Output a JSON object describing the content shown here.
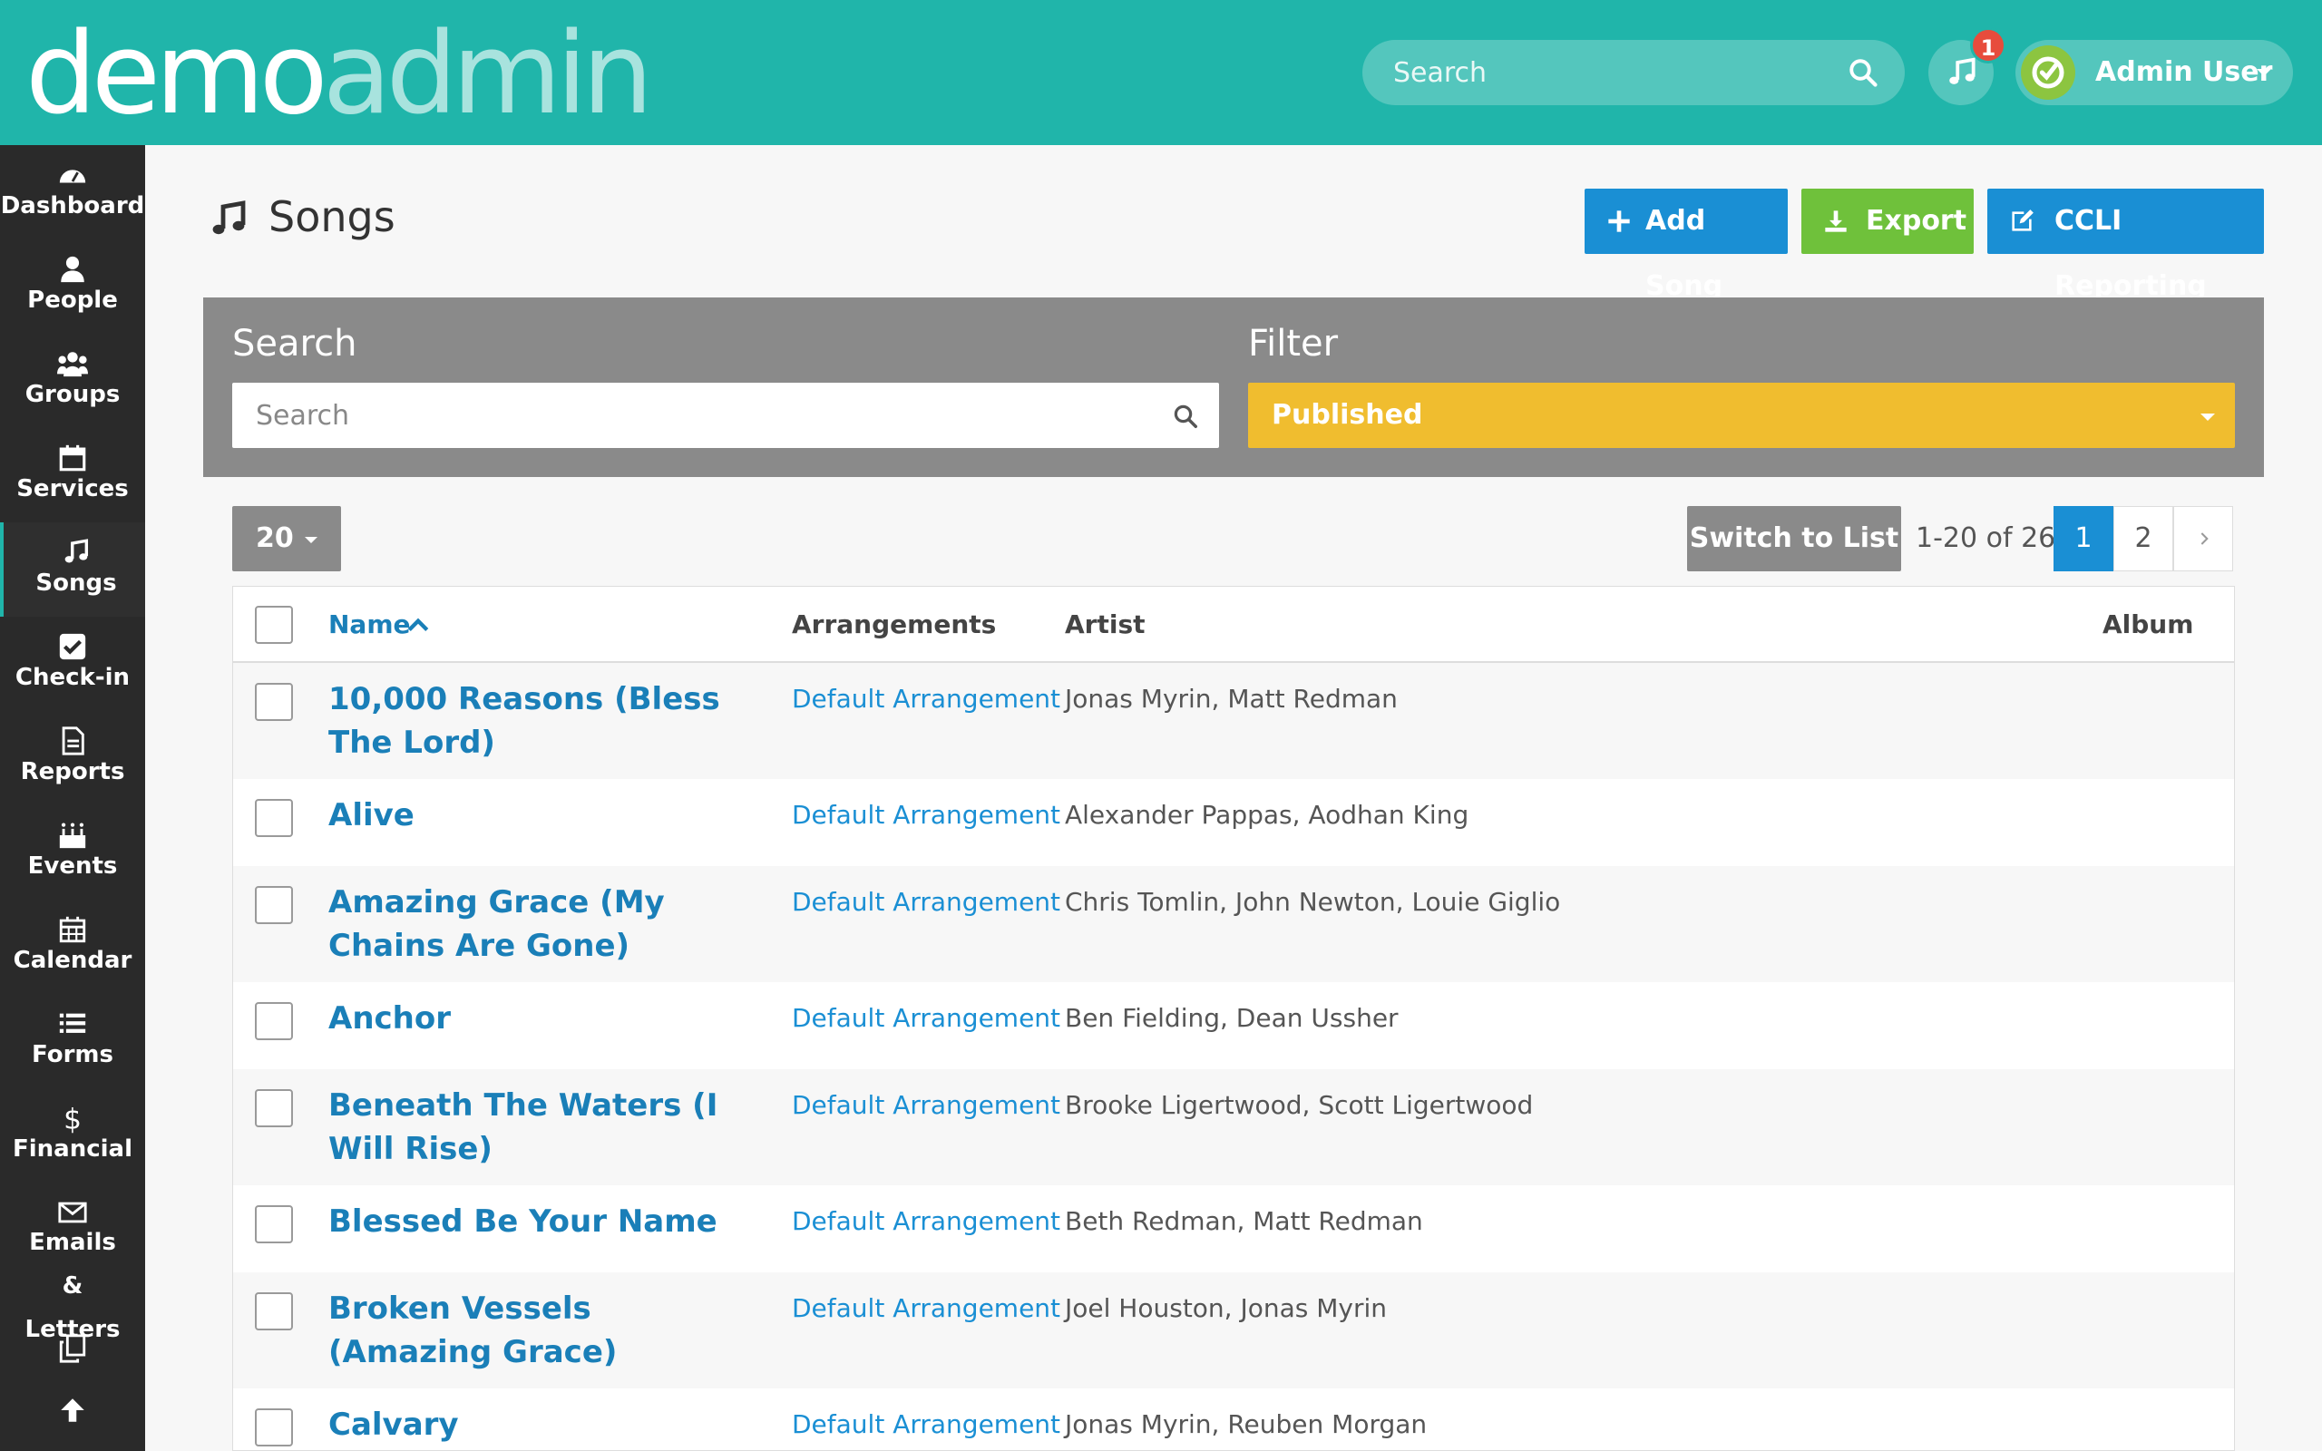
{
  "header": {
    "logo_demo": "demo",
    "logo_admin": "admin",
    "search_placeholder": "Search",
    "notification_count": "1",
    "user_name": "Admin User"
  },
  "sidebar": {
    "items": [
      {
        "label": "Dashboard",
        "icon": "dashboard-icon"
      },
      {
        "label": "People",
        "icon": "person-icon"
      },
      {
        "label": "Groups",
        "icon": "groups-icon"
      },
      {
        "label": "Services",
        "icon": "calendar-icon"
      },
      {
        "label": "Songs",
        "icon": "music-icon"
      },
      {
        "label": "Check-in",
        "icon": "check-square-icon"
      },
      {
        "label": "Reports",
        "icon": "document-icon"
      },
      {
        "label": "Events",
        "icon": "cake-icon"
      },
      {
        "label": "Calendar",
        "icon": "calendar-grid-icon"
      },
      {
        "label": "Forms",
        "icon": "list-icon"
      },
      {
        "label": "Financial",
        "icon": "dollar-icon"
      },
      {
        "label": "Emails & Letters",
        "icon": "envelope-icon"
      }
    ],
    "extra_icons": [
      "copy-icon",
      "arrow-up-icon"
    ],
    "active": "Songs"
  },
  "page": {
    "title": "Songs",
    "buttons": {
      "add": "Add Song",
      "export": "Export",
      "ccli": "CCLI Reporting"
    }
  },
  "filters": {
    "search_label": "Search",
    "search_placeholder": "Search",
    "filter_label": "Filter",
    "filter_value": "Published"
  },
  "toolbar": {
    "per_page": "20",
    "switch_label": "Switch to List",
    "range": "1-20 of 26",
    "pages": [
      "1",
      "2"
    ],
    "current_page": "1"
  },
  "table": {
    "columns": {
      "name": "Name",
      "arrangements": "Arrangements",
      "artist": "Artist",
      "album": "Album"
    },
    "rows": [
      {
        "name": "10,000 Reasons (Bless The Lord)",
        "arrangement": "Default Arrangement",
        "artist": "Jonas Myrin, Matt Redman"
      },
      {
        "name": "Alive",
        "arrangement": "Default Arrangement",
        "artist": "Alexander Pappas, Aodhan King"
      },
      {
        "name": "Amazing Grace (My Chains Are Gone)",
        "arrangement": "Default Arrangement",
        "artist": "Chris Tomlin, John Newton, Louie Giglio"
      },
      {
        "name": "Anchor",
        "arrangement": "Default Arrangement",
        "artist": "Ben Fielding, Dean Ussher"
      },
      {
        "name": "Beneath The Waters (I Will Rise)",
        "arrangement": "Default Arrangement",
        "artist": "Brooke Ligertwood, Scott Ligertwood"
      },
      {
        "name": "Blessed Be Your Name",
        "arrangement": "Default Arrangement",
        "artist": "Beth Redman, Matt Redman"
      },
      {
        "name": "Broken Vessels (Amazing Grace)",
        "arrangement": "Default Arrangement",
        "artist": "Joel Houston, Jonas Myrin"
      },
      {
        "name": "Calvary",
        "arrangement": "Default Arrangement",
        "artist": "Jonas Myrin, Reuben Morgan"
      }
    ]
  },
  "colors": {
    "header": "#20b5aa",
    "sidebar": "#2a2a2a",
    "primary": "#1a8fd4",
    "success": "#6fc13b",
    "warning": "#f0bd2f",
    "panel": "#8a8a8a"
  }
}
